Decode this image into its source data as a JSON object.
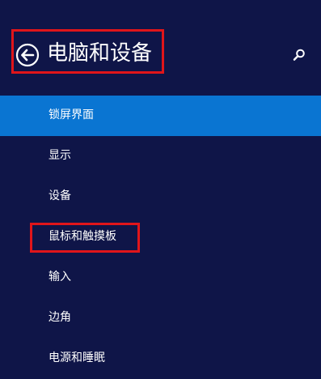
{
  "header": {
    "title": "电脑和设备",
    "back_icon": "back-arrow-icon",
    "search_icon": "search-icon"
  },
  "nav": {
    "items": [
      {
        "label": "锁屏界面",
        "selected": true
      },
      {
        "label": "显示",
        "selected": false
      },
      {
        "label": "设备",
        "selected": false
      },
      {
        "label": "鼠标和触摸板",
        "selected": false
      },
      {
        "label": "输入",
        "selected": false
      },
      {
        "label": "边角",
        "selected": false
      },
      {
        "label": "电源和睡眠",
        "selected": false
      }
    ]
  },
  "colors": {
    "background": "#0f1548",
    "selected": "#0a75d2",
    "annotation": "#e0151a",
    "text": "#ffffff"
  }
}
